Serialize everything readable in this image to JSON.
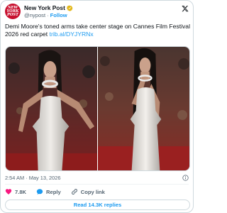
{
  "account": {
    "display_name": "New York Post",
    "handle": "@nypost",
    "separator": "·",
    "follow_label": "Follow",
    "avatar_text": [
      "NEW",
      "YORK",
      "POST"
    ]
  },
  "tweet": {
    "text": "Demi Moore's toned arms take center stage on Cannes Film Festival 2026 red carpet",
    "link_text": "trib.al/DYJYRNx"
  },
  "meta": {
    "time": "2:54 AM",
    "separator": "·",
    "date": "May 13, 2026"
  },
  "actions": {
    "likes_count": "7.8K",
    "reply_label": "Reply",
    "copy_link_label": "Copy link"
  },
  "read_replies_label": "Read 14.3K replies",
  "colors": {
    "accent": "#1d9bf0",
    "like_red": "#f91880",
    "brand_red": "#c8102e",
    "muted": "#536471"
  },
  "icons": {
    "verified": "verified-badge-icon",
    "x_logo": "x-logo-icon",
    "info": "info-icon",
    "heart": "heart-icon",
    "reply": "reply-bubble-icon",
    "link": "link-icon"
  }
}
